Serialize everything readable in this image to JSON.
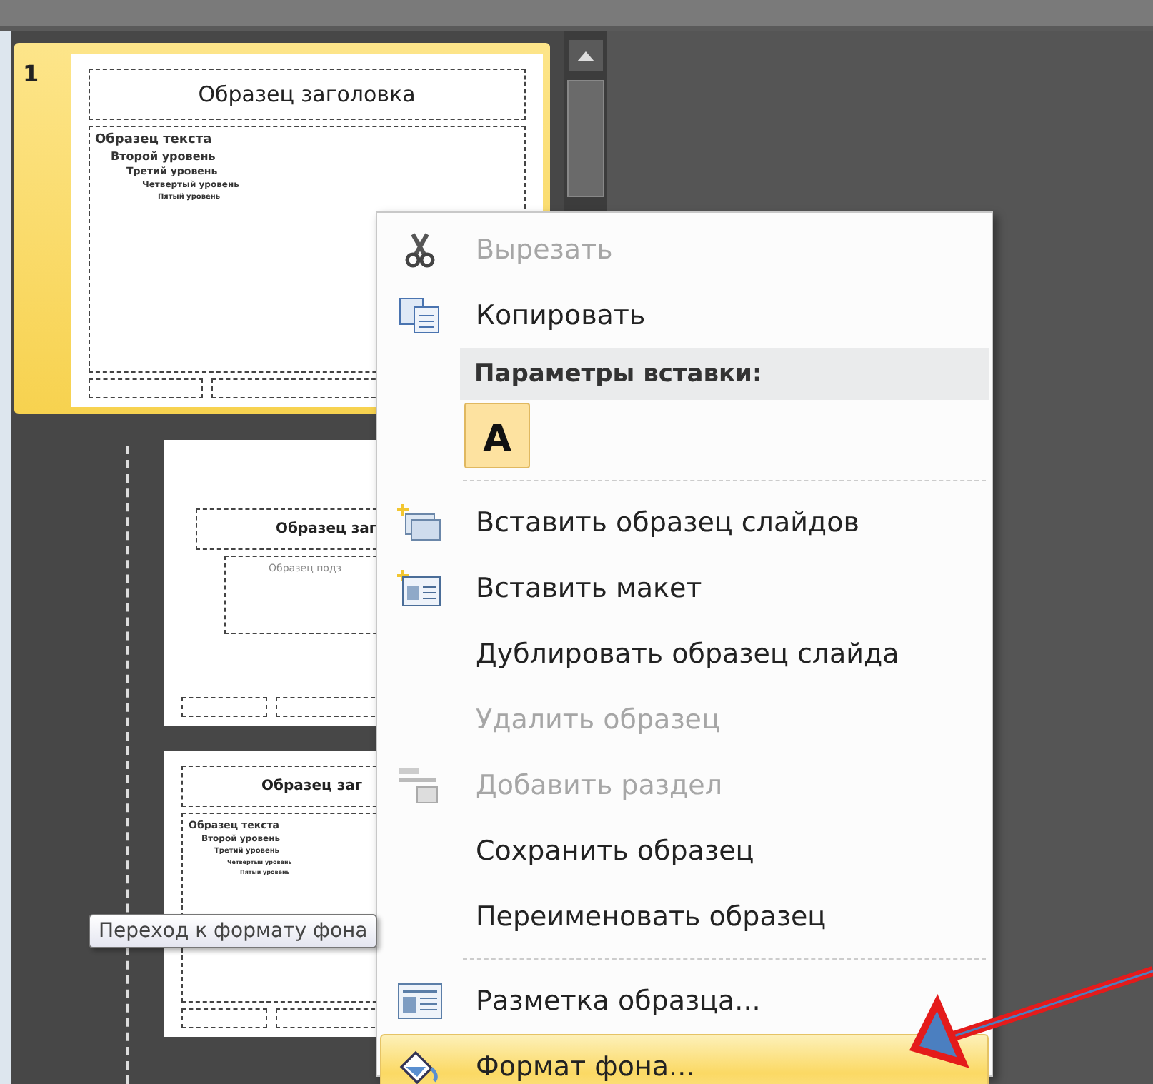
{
  "slides": [
    {
      "number": "1",
      "kind": "content",
      "selected": true,
      "title": "Образец заголовка",
      "body": [
        {
          "text": "Образец текста",
          "children": [
            {
              "text": "Второй уровень",
              "children": [
                {
                  "text": "Третий уровень",
                  "children": [
                    {
                      "text": "Четвертый уровень",
                      "children": [
                        {
                          "text": "Пятый уровень"
                        }
                      ]
                    }
                  ]
                }
              ]
            }
          ]
        }
      ]
    },
    {
      "kind": "title",
      "selected": false,
      "title": "Образец заг",
      "subtitle": "Образец подз"
    },
    {
      "kind": "content",
      "selected": false,
      "title": "Образец заг",
      "body": [
        {
          "text": "Образец текста",
          "children": [
            {
              "text": "Второй уровень",
              "children": [
                {
                  "text": "Третий уровень",
                  "children": [
                    {
                      "text": "Четвертый уровень",
                      "children": [
                        {
                          "text": "Пятый уровень"
                        }
                      ]
                    }
                  ]
                }
              ]
            }
          ]
        }
      ]
    }
  ],
  "context_menu": {
    "items": [
      {
        "kind": "item",
        "label": "Вырезать",
        "disabled": true,
        "selected": false
      },
      {
        "kind": "item",
        "label": "Копировать",
        "disabled": false,
        "selected": false
      },
      {
        "kind": "header",
        "label": "Параметры вставки:"
      },
      {
        "kind": "paste_options",
        "options": [
          {
            "label": "A"
          }
        ]
      },
      {
        "kind": "separator"
      },
      {
        "kind": "item",
        "label": "Вставить образец слайдов",
        "disabled": false,
        "selected": false
      },
      {
        "kind": "item",
        "label": "Вставить макет",
        "disabled": false,
        "selected": false
      },
      {
        "kind": "item",
        "label": "Дублировать образец слайда",
        "disabled": false,
        "selected": false
      },
      {
        "kind": "item",
        "label": "Удалить образец",
        "disabled": true,
        "selected": false
      },
      {
        "kind": "item",
        "label": "Добавить раздел",
        "disabled": true,
        "selected": false
      },
      {
        "kind": "item",
        "label": "Сохранить образец",
        "disabled": false,
        "selected": false
      },
      {
        "kind": "item",
        "label": "Переименовать образец",
        "disabled": false,
        "selected": false
      },
      {
        "kind": "separator"
      },
      {
        "kind": "item",
        "label": "Разметка образца...",
        "disabled": false,
        "selected": false
      },
      {
        "kind": "item",
        "label": "Формат фона...",
        "disabled": false,
        "selected": true
      }
    ]
  },
  "tooltip": "Переход к формату фона"
}
